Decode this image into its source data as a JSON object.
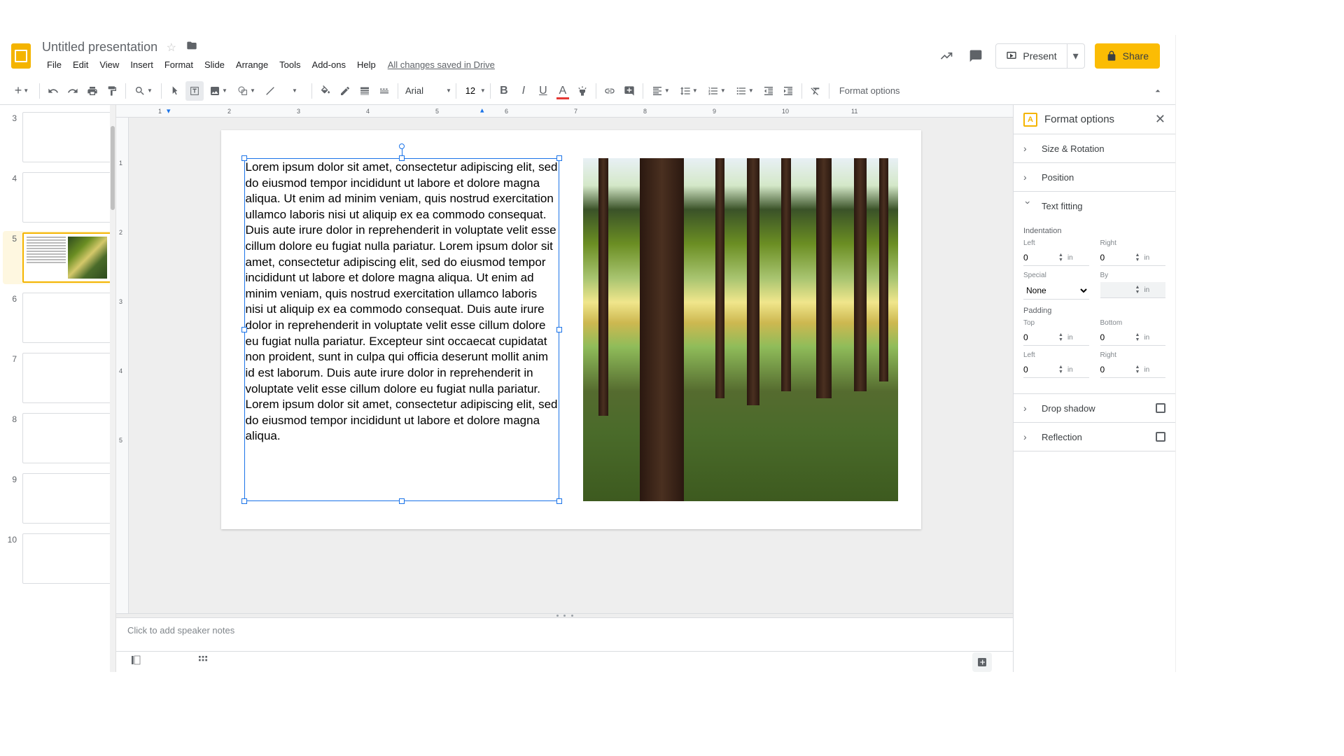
{
  "doc": {
    "title": "Untitled presentation",
    "save_status": "All changes saved in Drive"
  },
  "menu": {
    "file": "File",
    "edit": "Edit",
    "view": "View",
    "insert": "Insert",
    "format": "Format",
    "slide": "Slide",
    "arrange": "Arrange",
    "tools": "Tools",
    "addons": "Add-ons",
    "help": "Help"
  },
  "header_buttons": {
    "present": "Present",
    "share": "Share"
  },
  "toolbar": {
    "font_name": "Arial",
    "font_size": "12",
    "format_options": "Format options"
  },
  "filmstrip": {
    "slides": [
      {
        "num": "3"
      },
      {
        "num": "4"
      },
      {
        "num": "5",
        "selected": true,
        "has_content": true
      },
      {
        "num": "6"
      },
      {
        "num": "7"
      },
      {
        "num": "8"
      },
      {
        "num": "9"
      },
      {
        "num": "10"
      }
    ]
  },
  "slide": {
    "textbox_content": "Lorem ipsum dolor sit amet, consectetur adipiscing elit, sed do eiusmod tempor incididunt ut labore et dolore magna aliqua. Ut enim ad minim veniam, quis nostrud exercitation ullamco laboris nisi ut aliquip ex ea commodo consequat. Duis aute irure dolor in reprehenderit in voluptate velit esse cillum dolore eu fugiat nulla pariatur. Lorem ipsum dolor sit amet, consectetur adipiscing elit, sed do eiusmod tempor incididunt ut labore et dolore magna aliqua. Ut enim ad minim veniam, quis nostrud exercitation ullamco laboris nisi ut aliquip ex ea commodo consequat. Duis aute irure dolor in reprehenderit in voluptate velit esse cillum dolore eu fugiat nulla pariatur. Excepteur sint occaecat cupidatat non proident, sunt in culpa qui officia deserunt mollit anim id est laborum. Duis aute irure dolor in reprehenderit in voluptate velit esse cillum dolore eu fugiat nulla pariatur. Lorem ipsum dolor sit amet, consectetur adipiscing elit, sed do eiusmod tempor incididunt ut labore et dolore magna aliqua."
  },
  "notes": {
    "placeholder": "Click to add speaker notes"
  },
  "ruler": {
    "ticks": [
      "1",
      "2",
      "3",
      "4",
      "5",
      "6",
      "7",
      "8",
      "9",
      "10",
      "11"
    ],
    "vticks": [
      "1",
      "2",
      "3",
      "4",
      "5"
    ]
  },
  "panel": {
    "title": "Format options",
    "sections": {
      "size_rotation": "Size & Rotation",
      "position": "Position",
      "text_fitting": "Text fitting",
      "drop_shadow": "Drop shadow",
      "reflection": "Reflection"
    },
    "text_fitting": {
      "indentation": "Indentation",
      "left_label": "Left",
      "left_val": "0",
      "right_label": "Right",
      "right_val": "0",
      "special_label": "Special",
      "special_val": "None",
      "by_label": "By",
      "by_val": "",
      "padding": "Padding",
      "top_label": "Top",
      "top_val": "0",
      "bottom_label": "Bottom",
      "bottom_val": "0",
      "pleft_label": "Left",
      "pleft_val": "0",
      "pright_label": "Right",
      "pright_val": "0",
      "unit": "in"
    }
  }
}
